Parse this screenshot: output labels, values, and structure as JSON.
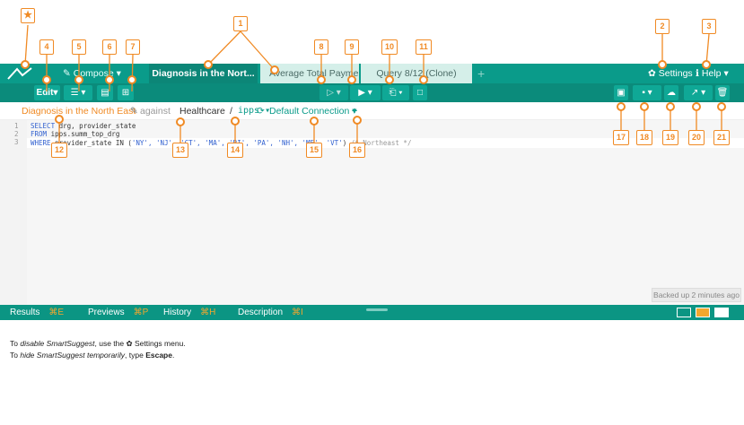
{
  "tabs": {
    "compose": "Compose",
    "active": "Diagnosis in the Nort...",
    "avg": "Average Total Payme...",
    "query": "Query 8/12 (Clone)",
    "add": "+"
  },
  "header_right": {
    "settings": "Settings",
    "help": "Help"
  },
  "toolbar": {
    "edit": "Edit"
  },
  "query_header": {
    "name": "Diagnosis in the North East",
    "against": "against",
    "database": "Healthcare",
    "sep": "/",
    "schema": "ipps",
    "connection": "Default Connection",
    "plus": "+"
  },
  "editor": {
    "line_numbers": [
      "1",
      "2",
      "3"
    ],
    "line1_kw": "SELECT",
    "line1_rest": " drg, provider_state",
    "line2_kw": "FROM",
    "line2_rest": " ipps.summ_top_drg",
    "line3_kw": "WHERE",
    "line3_rest": " provider_state IN (",
    "line3_vals": "'NY', 'NJ', 'CT', 'MA', 'RI', 'PA', 'NH', 'ME', 'VT'",
    "line3_end": ") ",
    "line3_comment": "/* Northeast */",
    "backup": "Backed up 2 minutes ago"
  },
  "bottom_tabs": [
    {
      "label": "Results",
      "hotkey": "⌘E"
    },
    {
      "label": "Previews",
      "hotkey": "⌘P"
    },
    {
      "label": "History",
      "hotkey": "⌘H"
    },
    {
      "label": "Description",
      "hotkey": "⌘I"
    }
  ],
  "hint": {
    "l1_a": "To ",
    "l1_em": "disable SmartSuggest",
    "l1_b": ", use the ",
    "l1_icon": "✿",
    "l1_c": " Settings menu.",
    "l2_a": "To ",
    "l2_em": "hide SmartSuggest temporarily",
    "l2_b": ", type ",
    "l2_strong": "Escape",
    "l2_c": "."
  },
  "callouts": {
    "star": "★",
    "n1": "1",
    "n2": "2",
    "n3": "3",
    "n4": "4",
    "n5": "5",
    "n6": "6",
    "n7": "7",
    "n8": "8",
    "n9": "9",
    "n10": "10",
    "n11": "11",
    "n12": "12",
    "n13": "13",
    "n14": "14",
    "n15": "15",
    "n16": "16",
    "n17": "17",
    "n18": "18",
    "n19": "19",
    "n20": "20",
    "n21": "21"
  },
  "colors": {
    "accent": "#0a9b8a",
    "callout": "#f08a24",
    "hotkey": "#f3a72d"
  }
}
